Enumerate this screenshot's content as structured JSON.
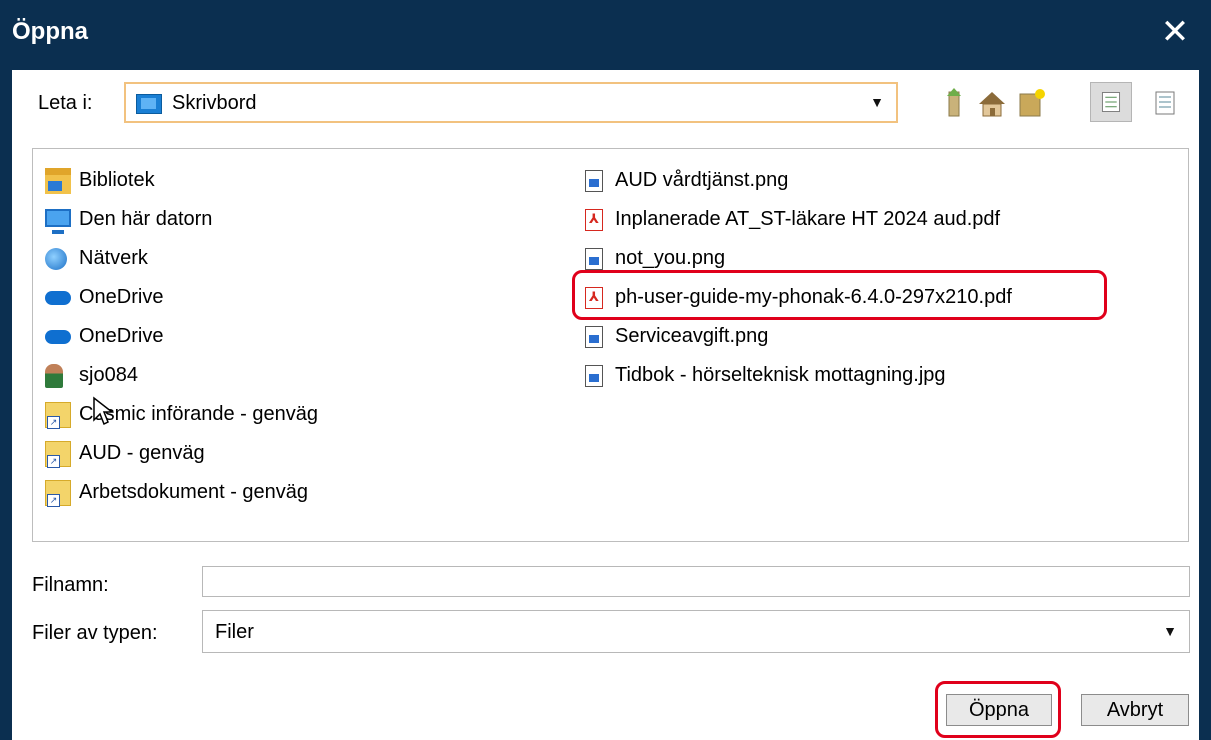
{
  "window": {
    "title": "Öppna",
    "close_icon": "close-icon"
  },
  "lookin": {
    "label": "Leta i:",
    "value": "Skrivbord",
    "folder_icon": "desktop-folder-icon"
  },
  "toolbar": {
    "icons": [
      "up-folder-icon",
      "home-icon",
      "new-folder-icon",
      "list-view-icon",
      "details-view-icon"
    ]
  },
  "files": {
    "left": [
      {
        "label": "Bibliotek",
        "icon": "library-icon"
      },
      {
        "label": "Den här datorn",
        "icon": "computer-icon"
      },
      {
        "label": "Nätverk",
        "icon": "network-icon"
      },
      {
        "label": "OneDrive",
        "icon": "cloud-icon"
      },
      {
        "label": "OneDrive",
        "icon": "cloud-icon"
      },
      {
        "label": "sjo084",
        "icon": "user-icon"
      },
      {
        "label": "Cosmic införande - genväg",
        "icon": "shortcut-folder-icon"
      },
      {
        "label": "AUD - genväg",
        "icon": "shortcut-folder-icon"
      },
      {
        "label": "Arbetsdokument - genväg",
        "icon": "shortcut-folder-icon"
      }
    ],
    "right": [
      {
        "label": "AUD vårdtjänst.png",
        "icon": "image-file-icon"
      },
      {
        "label": "Inplanerade AT_ST-läkare HT 2024 aud.pdf",
        "icon": "pdf-file-icon"
      },
      {
        "label": "not_you.png",
        "icon": "image-file-icon"
      },
      {
        "label": "ph-user-guide-my-phonak-6.4.0-297x210.pdf",
        "icon": "pdf-file-icon"
      },
      {
        "label": "Serviceavgift.png",
        "icon": "image-file-icon"
      },
      {
        "label": "Tidbok - hörselteknisk mottagning.jpg",
        "icon": "image-file-icon"
      }
    ]
  },
  "form": {
    "filename_label": "Filnamn:",
    "filename_value": "",
    "filetype_label": "Filer av typen:",
    "filetype_value": "Filer"
  },
  "buttons": {
    "open": "Öppna",
    "cancel": "Avbryt"
  },
  "colors": {
    "titlebar": "#0b2f50",
    "highlight": "#e0001b"
  }
}
